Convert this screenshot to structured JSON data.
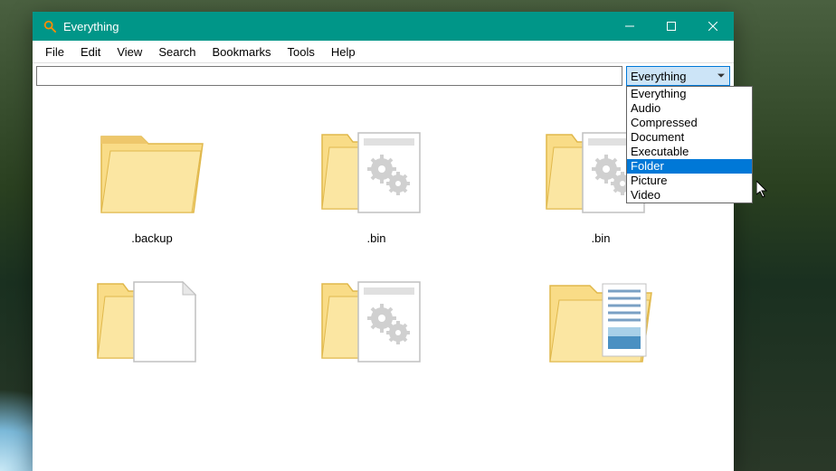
{
  "window": {
    "title": "Everything"
  },
  "menubar": [
    "File",
    "Edit",
    "View",
    "Search",
    "Bookmarks",
    "Tools",
    "Help"
  ],
  "toolbar": {
    "search_value": "",
    "search_placeholder": "",
    "filter_selected": "Everything",
    "filter_options": [
      "Everything",
      "Audio",
      "Compressed",
      "Document",
      "Executable",
      "Folder",
      "Picture",
      "Video"
    ],
    "filter_highlighted_index": 5
  },
  "items": [
    {
      "name": ".backup",
      "icon": "folder-plain"
    },
    {
      "name": ".bin",
      "icon": "folder-gears"
    },
    {
      "name": ".bin",
      "icon": "folder-gears"
    },
    {
      "name": "",
      "icon": "folder-doc"
    },
    {
      "name": "",
      "icon": "folder-gears"
    },
    {
      "name": "",
      "icon": "folder-thumbs"
    }
  ],
  "colors": {
    "accent": "#009688",
    "selection": "#0078d7",
    "folder_fill": "#f9dc87",
    "folder_edge": "#e0b84c"
  }
}
